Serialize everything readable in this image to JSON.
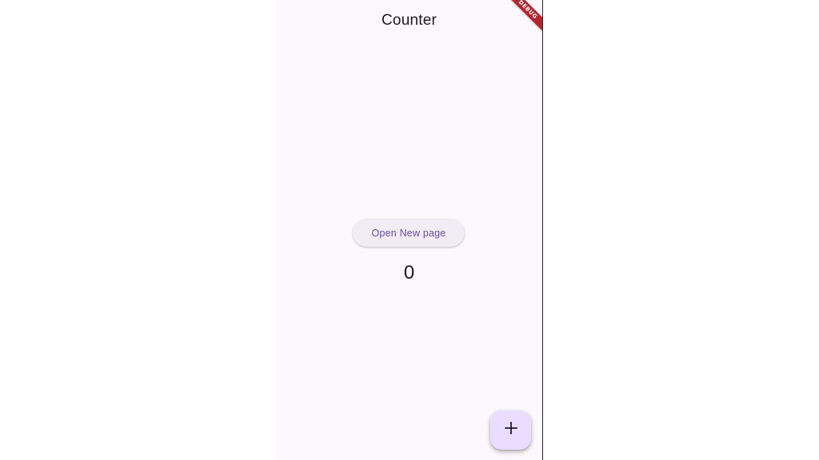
{
  "app": {
    "title": "Counter",
    "debug_banner": "DEBUG"
  },
  "main": {
    "open_button_label": "Open New page",
    "counter_value": "0"
  },
  "fab": {
    "icon": "add-icon"
  },
  "colors": {
    "background": "#fcf8fd",
    "primary": "#6750a4",
    "fab_background": "#eaddff",
    "button_background": "#f2ecf5",
    "debug_banner": "#b3262d"
  }
}
